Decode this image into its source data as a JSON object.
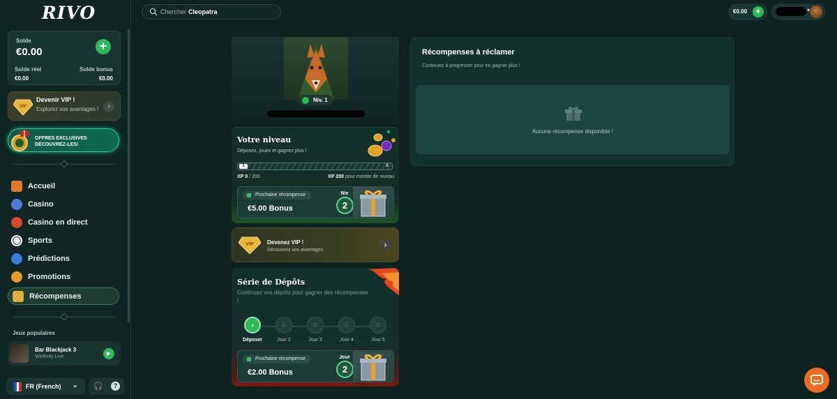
{
  "brand": {
    "logo": "RIVO"
  },
  "header": {
    "search_placeholder": "Chercher",
    "search_term": "Cleopatra",
    "balance": "€0.00"
  },
  "wallet": {
    "title": "Solde",
    "amount": "€0.00",
    "real_label": "Solde réel",
    "real_value": "€0.00",
    "bonus_label": "Solde bonus",
    "bonus_value": "€0.00"
  },
  "vip_side": {
    "title": "Devenir VIP !",
    "subtitle": "Explorez vos avantages !"
  },
  "offer": {
    "line1": "OFFRES EXCLUSIVES",
    "line2": "DÉCOUVREZ-LES!"
  },
  "nav": [
    {
      "label": "Accueil",
      "color": "#e3772b"
    },
    {
      "label": "Casino",
      "color": "#4f7ad6"
    },
    {
      "label": "Casino en direct",
      "color": "#d9472f"
    },
    {
      "label": "Sports",
      "color": "#e8e8e8"
    },
    {
      "label": "Prédictions",
      "color": "#3e7ad8"
    },
    {
      "label": "Promotions",
      "color": "#e89a2a"
    },
    {
      "label": "Récompenses",
      "color": "#e2b03a"
    }
  ],
  "popular": {
    "title": "Jeux populaires",
    "game_name": "Bar Blackjack 3",
    "game_provider": "Winfinity Live"
  },
  "language": {
    "label": "FR (French)"
  },
  "profile": {
    "level_pill": "Niv. 1"
  },
  "level": {
    "title": "Votre niveau",
    "subtitle": "Déposez, jouez et gagnez plus !",
    "from_level": "1",
    "to_level": "2",
    "xp_current_label": "XP",
    "xp_current": "0",
    "xp_total": "/ 200",
    "xp_needed": "XP 200",
    "xp_needed_suffix": "pour monter de niveau",
    "next_reward_label": "Prochaine récompense",
    "next_reward_value": "€5.00 Bonus",
    "next_reward_level_label": "Niv",
    "next_reward_level": "2",
    "progress_fraction": 0
  },
  "vip_card": {
    "title": "Devenez VIP !",
    "subtitle": "Découvrez vos avantages"
  },
  "deposit": {
    "title": "Série de Dépôts",
    "subtitle": "Continuez vos dépôts pour gagner des récompenses !",
    "steps": [
      "Déposer",
      "Jour 2",
      "Jour 3",
      "Jour 4",
      "Jour 5"
    ],
    "next_reward_label": "Prochaine récompense",
    "next_reward_value": "€2.00 Bonus",
    "next_reward_day_label": "Jour",
    "next_reward_day": "2"
  },
  "rewards": {
    "title": "Récompenses à réclamer",
    "subtitle": "Continuez à progresser pour en gagner plus !",
    "empty_text": "Aucune récompense disponible !"
  }
}
